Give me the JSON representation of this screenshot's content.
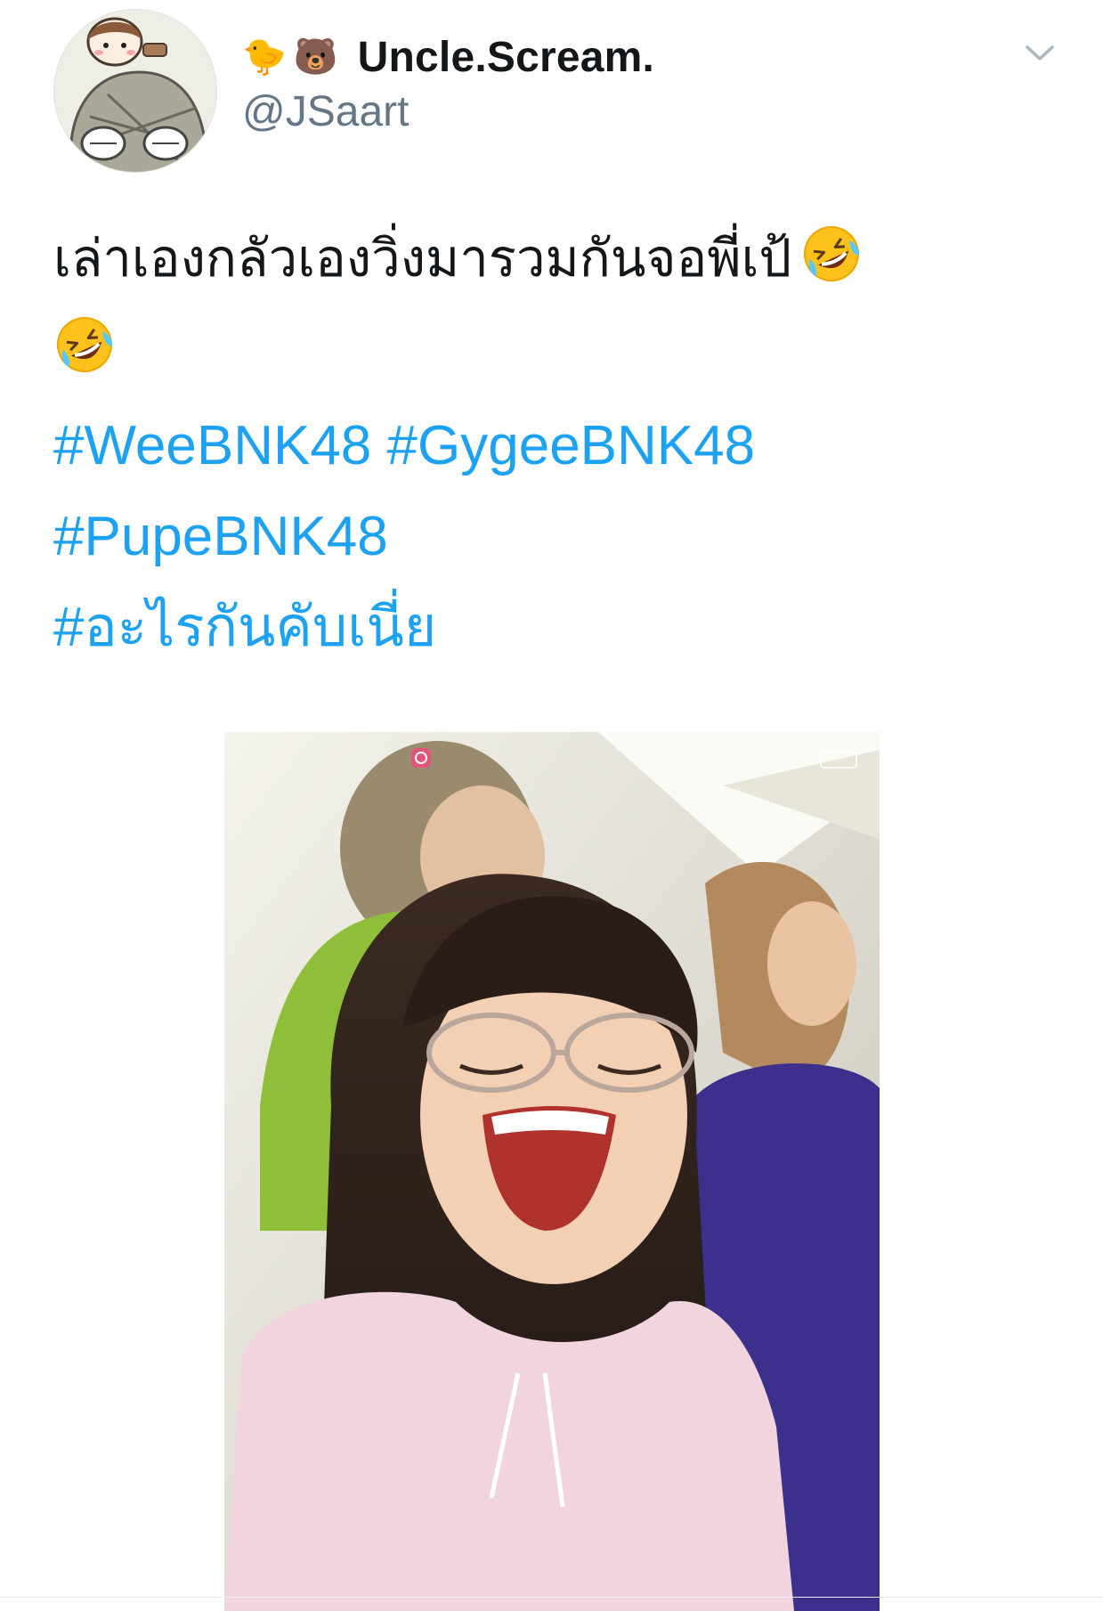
{
  "user": {
    "emoji_1": "🐤",
    "emoji_2": "🐻",
    "display_name": "Uncle.Scream.",
    "handle": "@JSaart"
  },
  "icons": {
    "caret": "chevron-down-icon",
    "laugh": "rolling-on-floor-laughing-emoji"
  },
  "tweet": {
    "text": "เล่าเองกลัวเองวิ่งมารวมกันจอพี่เป้",
    "hashtags": [
      "#WeeBNK48",
      "#GygeeBNK48",
      "#PupeBNK48",
      "#อะไรกันคับเนี่ย"
    ]
  },
  "colors": {
    "link": "#1da1f2",
    "secondary_text": "#657786"
  }
}
